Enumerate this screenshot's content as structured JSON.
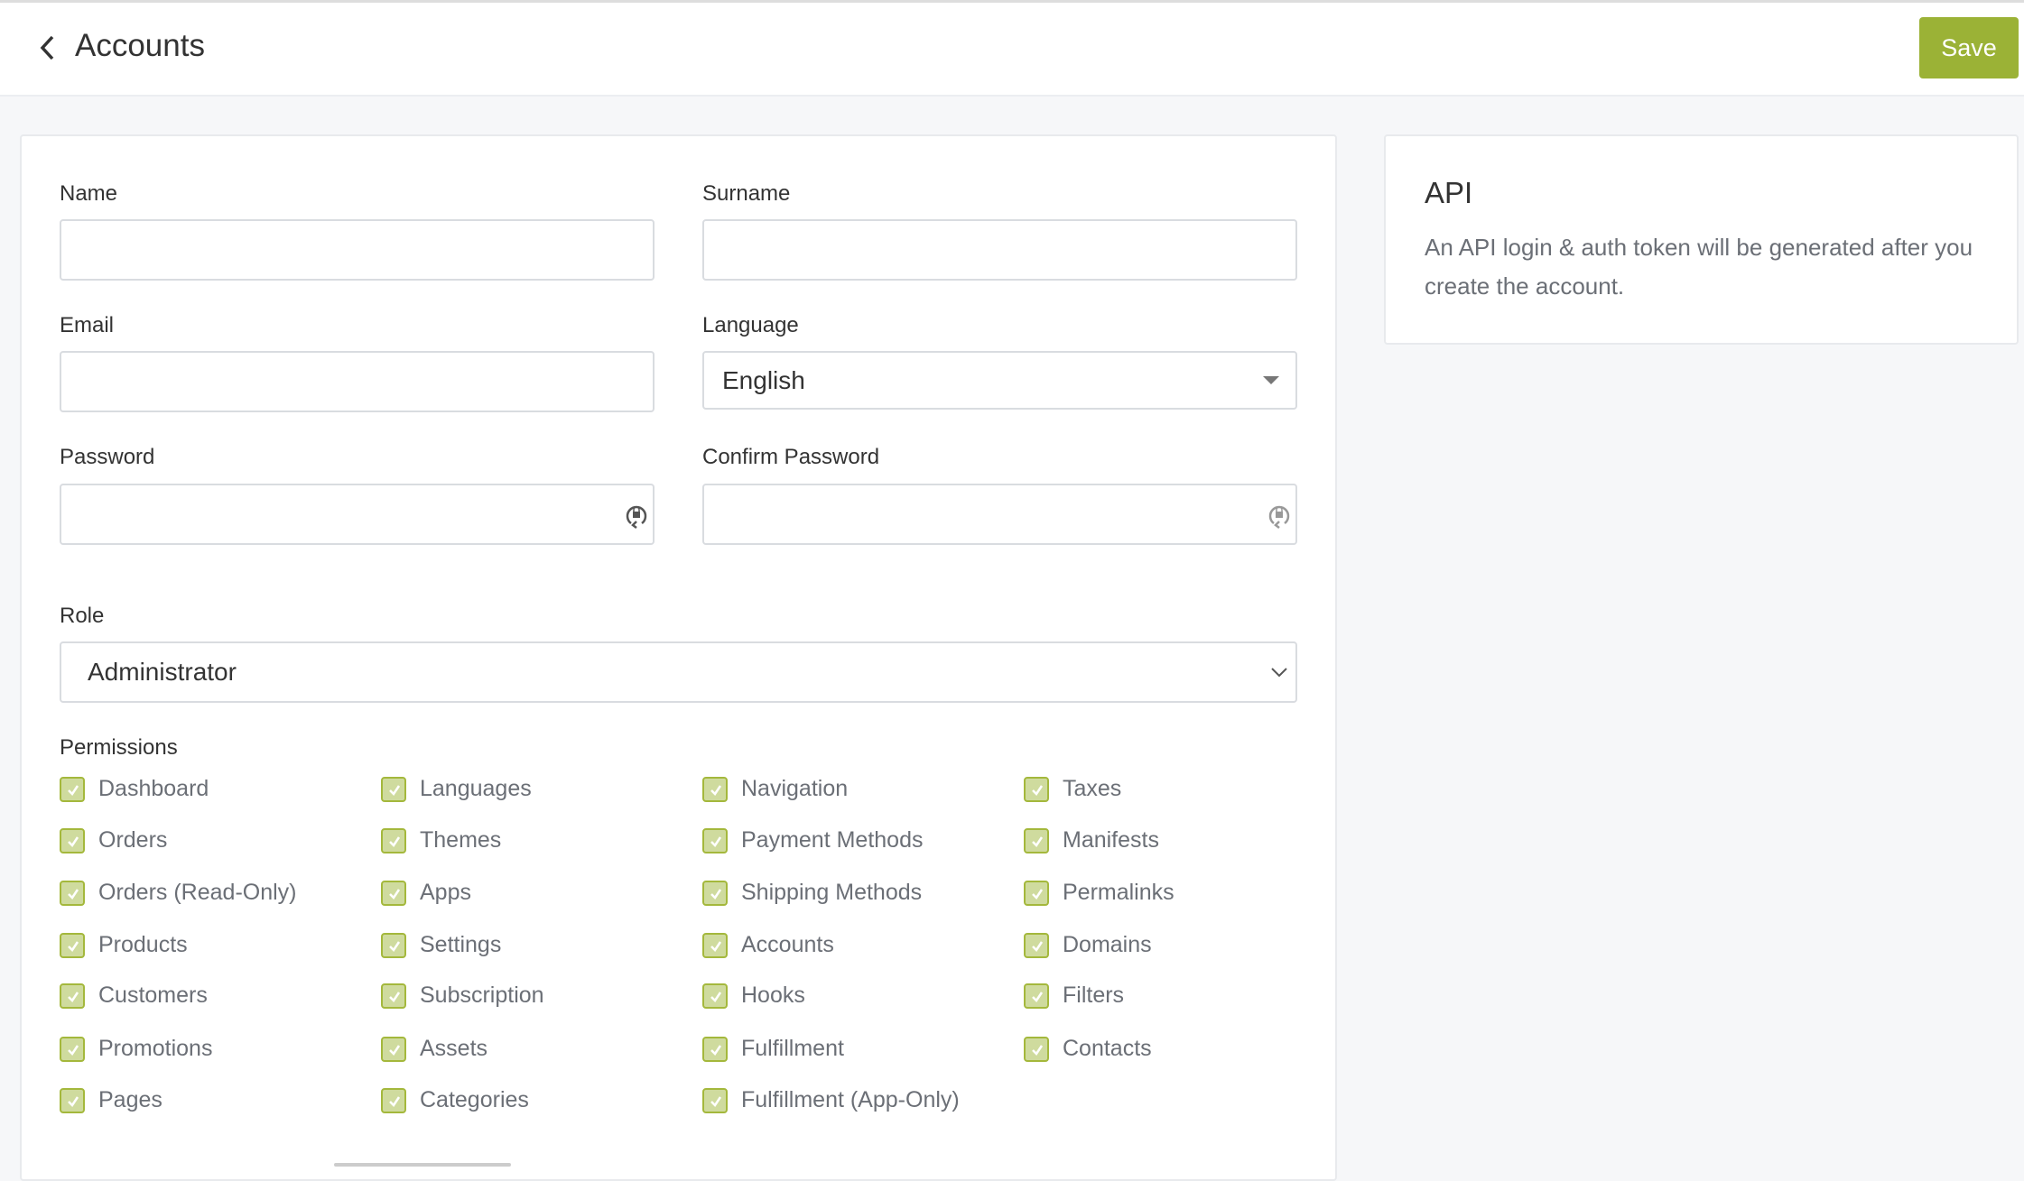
{
  "header": {
    "title": "Accounts",
    "save_label": "Save"
  },
  "form": {
    "name_label": "Name",
    "surname_label": "Surname",
    "email_label": "Email",
    "language_label": "Language",
    "language_value": "English",
    "password_label": "Password",
    "confirm_password_label": "Confirm Password",
    "role_label": "Role",
    "role_value": "Administrator",
    "permissions_label": "Permissions"
  },
  "permissions": [
    [
      "Dashboard",
      "Orders",
      "Orders (Read-Only)",
      "Products",
      "Customers",
      "Promotions",
      "Pages"
    ],
    [
      "Languages",
      "Themes",
      "Apps",
      "Settings",
      "Subscription",
      "Assets",
      "Categories"
    ],
    [
      "Navigation",
      "Payment Methods",
      "Shipping Methods",
      "Accounts",
      "Hooks",
      "Fulfillment",
      "Fulfillment (App-Only)"
    ],
    [
      "Taxes",
      "Manifests",
      "Permalinks",
      "Domains",
      "Filters",
      "Contacts"
    ]
  ],
  "api": {
    "title": "API",
    "description": "An API login & auth token will be generated after you create the account."
  },
  "colors": {
    "accent": "#9bb236",
    "checkbox_fill": "#cfdb9e"
  }
}
